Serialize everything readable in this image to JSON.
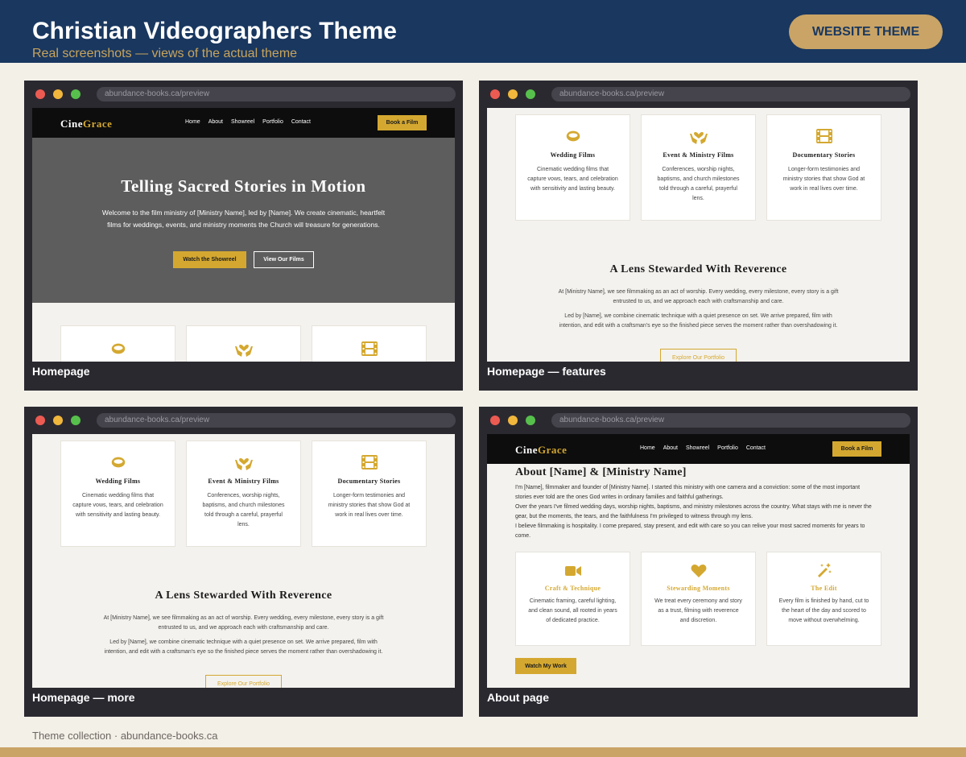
{
  "header": {
    "title": "Christian Videographers Theme",
    "subtitle": "Real screenshots — views of the actual theme",
    "badge": "WEBSITE THEME"
  },
  "browser": {
    "url": "abundance-books.ca/preview"
  },
  "site": {
    "logo_cine": "Cine",
    "logo_grace": "Grace",
    "nav": [
      "Home",
      "About",
      "Showreel",
      "Portfolio",
      "Contact"
    ],
    "book_button": "Book a Film"
  },
  "hero": {
    "title": "Telling Sacred Stories in Motion",
    "text": "Welcome to the film ministry of [Ministry Name], led by [Name]. We create cinematic, heartfelt films for weddings, events, and ministry moments the Church will treasure for generations.",
    "primary_button": "Watch the Showreel",
    "secondary_button": "View Our Films"
  },
  "features": [
    {
      "icon": "ring-icon",
      "title": "Wedding Films",
      "text": "Cinematic wedding films that capture vows, tears, and celebration with sensitivity and lasting beauty."
    },
    {
      "icon": "hands-heart-icon",
      "title": "Event & Ministry Films",
      "text": "Conferences, worship nights, baptisms, and church milestones told through a careful, prayerful lens."
    },
    {
      "icon": "film-icon",
      "title": "Documentary Stories",
      "text": "Longer-form testimonies and ministry stories that show God at work in real lives over time."
    }
  ],
  "lens": {
    "title": "A Lens Stewarded With Reverence",
    "p1": "At [Ministry Name], we see filmmaking as an act of worship. Every wedding, every milestone, every story is a gift entrusted to us, and we approach each with craftsmanship and care.",
    "p2": "Led by [Name], we combine cinematic technique with a quiet presence on set. We arrive prepared, film with intention, and edit with a craftsman's eye so the finished piece serves the moment rather than overshadowing it.",
    "button": "Explore Our Portfolio"
  },
  "about": {
    "title": "About [Name] & [Ministry Name]",
    "p1": "I'm [Name], filmmaker and founder of [Ministry Name]. I started this ministry with one camera and a conviction: some of the most important stories ever told are the ones God writes in ordinary families and faithful gatherings.",
    "p2": "Over the years I've filmed wedding days, worship nights, baptisms, and ministry milestones across the country. What stays with me is never the gear, but the moments, the tears, and the faithfulness I'm privileged to witness through my lens.",
    "p3": "I believe filmmaking is hospitality. I come prepared, stay present, and edit with care so you can relive your most sacred moments for years to come.",
    "values": [
      {
        "icon": "video-camera-icon",
        "title": "Craft & Technique",
        "text": "Cinematic framing, careful lighting, and clean sound, all rooted in years of dedicated practice."
      },
      {
        "icon": "heart-icon",
        "title": "Stewarding Moments",
        "text": "We treat every ceremony and story as a trust, filming with reverence and discretion."
      },
      {
        "icon": "magic-wand-icon",
        "title": "The Edit",
        "text": "Every film is finished by hand, cut to the heart of the day and scored to move without overwhelming."
      }
    ],
    "button": "Watch My Work"
  },
  "captions": [
    "Homepage",
    "Homepage — features",
    "Homepage — more",
    "About page"
  ],
  "footer": "Theme collection · abundance-books.ca",
  "colors": {
    "navy": "#19375f",
    "gold": "#c9a466",
    "accent": "#d4a830"
  }
}
